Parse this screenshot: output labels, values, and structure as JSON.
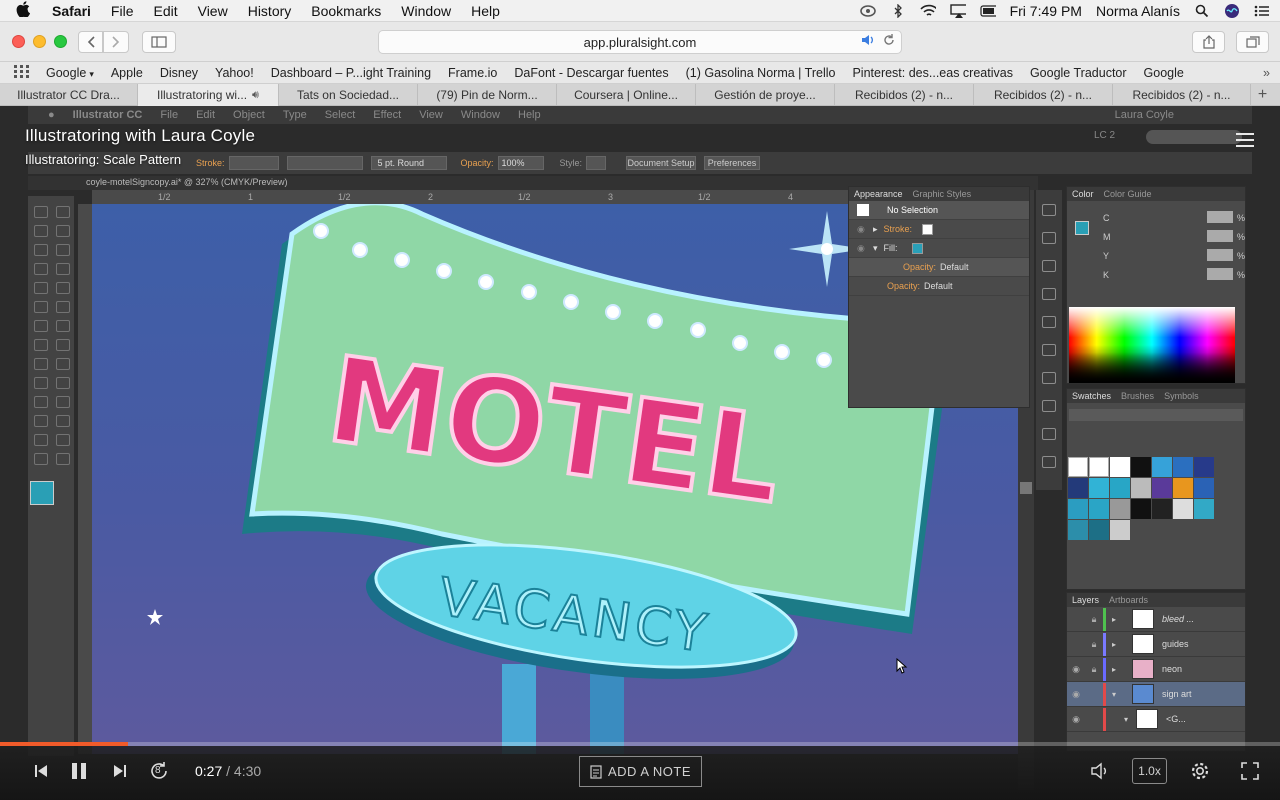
{
  "menubar": {
    "app": "Safari",
    "items": [
      "File",
      "Edit",
      "View",
      "History",
      "Bookmarks",
      "Window",
      "Help"
    ],
    "clock": "Fri 7:49 PM",
    "user": "Norma Alanís"
  },
  "toolbar": {
    "url": "app.pluralsight.com"
  },
  "bookmarks": {
    "items": [
      "Google",
      "Apple",
      "Disney",
      "Yahoo!",
      "Dashboard – P...ight Training",
      "Frame.io",
      "DaFont - Descargar fuentes",
      "(1) Gasolina Norma | Trello",
      "Pinterest: des...eas creativas",
      "Google Traductor",
      "Google"
    ]
  },
  "tabs": [
    {
      "label": "Illustrator CC Dra..."
    },
    {
      "label": "Illustratoring wi..."
    },
    {
      "label": "Tats on Sociedad..."
    },
    {
      "label": "(79) Pin de Norm..."
    },
    {
      "label": "Coursera | Online..."
    },
    {
      "label": "Gestión de proye..."
    },
    {
      "label": "Recibidos (2) - n..."
    },
    {
      "label": "Recibidos (2) - n..."
    },
    {
      "label": "Recibidos (2) - n..."
    }
  ],
  "illustrator": {
    "app_menu": [
      "Illustrator CC",
      "File",
      "Edit",
      "Object",
      "Type",
      "Select",
      "Effect",
      "View",
      "Window",
      "Help"
    ],
    "user": "Laura Coyle",
    "workspace": "LC 2",
    "doc_tab": "coyle-motelSigncopy.ai* @ 327% (CMYK/Preview)",
    "stroke_label": "Stroke:",
    "brush": "5 pt. Round",
    "opacity_label": "Opacity:",
    "opacity_value": "100%",
    "style_label": "Style:",
    "doc_setup": "Document Setup",
    "preferences": "Preferences",
    "ruler_marks": [
      "1/2",
      "1",
      "1/2",
      "2",
      "1/2",
      "3",
      "1/2",
      "4"
    ],
    "appearance": {
      "tabs": [
        "Appearance",
        "Graphic Styles"
      ],
      "title": "No Selection",
      "rows": [
        {
          "label": "Stroke:",
          "value": ""
        },
        {
          "label": "Fill:",
          "value": ""
        },
        {
          "label": "Opacity:",
          "value": "Default"
        },
        {
          "label": "Opacity:",
          "value": "Default"
        }
      ]
    },
    "color": {
      "tabs": [
        "Color",
        "Color Guide"
      ],
      "channels": [
        "C",
        "M",
        "Y",
        "K"
      ],
      "unit": "%"
    },
    "swatches": {
      "tabs": [
        "Swatches",
        "Brushes",
        "Symbols"
      ]
    },
    "layers": {
      "tabs": [
        "Layers",
        "Artboards"
      ],
      "rows": [
        {
          "name": "bleed ...",
          "color": "#4fc24f"
        },
        {
          "name": "guides",
          "color": "#7a7aff"
        },
        {
          "name": "neon",
          "color": "#6a6aff"
        },
        {
          "name": "sign art",
          "color": "#e24a4a"
        },
        {
          "name": "<G...",
          "color": "#e24a4a"
        }
      ]
    },
    "sign": {
      "top_word": "MOTEL",
      "bottom_word": "VACANCY"
    }
  },
  "player": {
    "course_title": "Illustratoring with Laura Coyle",
    "clip_title": "Illustratoring: Scale Pattern",
    "current_time": "0:27",
    "separator": "/",
    "duration": "4:30",
    "progress_fraction": 0.1,
    "add_note": "ADD A NOTE",
    "speed": "1.0x",
    "replay_seconds": "8",
    "accent": "#f15b2a"
  }
}
